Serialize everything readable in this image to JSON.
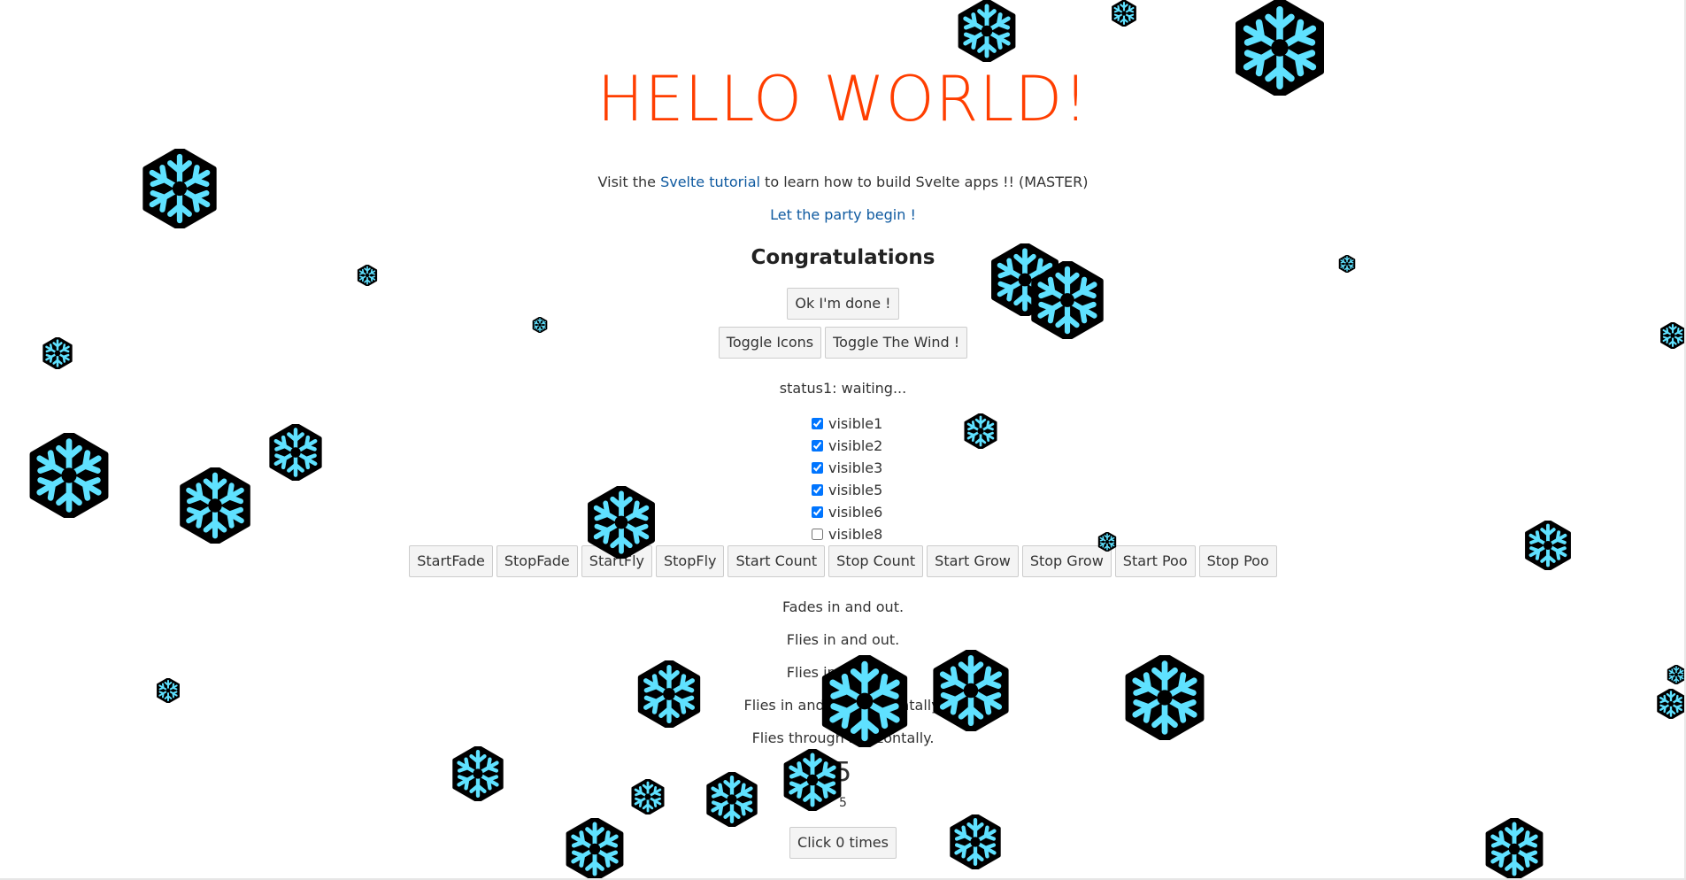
{
  "header": {
    "title": "HELLO WORLD!"
  },
  "intro": {
    "prefix": "Visit the ",
    "link": "Svelte tutorial",
    "suffix": " to learn how to build Svelte apps !! (MASTER)"
  },
  "party_link": "Let the party begin !",
  "congrats": "Congratulations",
  "buttons": {
    "done": "Ok I'm done !",
    "toggle_icons": "Toggle Icons",
    "toggle_wind": "Toggle The Wind !"
  },
  "status": "status1: waiting...",
  "checkboxes": [
    {
      "label": "visible1",
      "checked": true
    },
    {
      "label": "visible2",
      "checked": true
    },
    {
      "label": "visible3",
      "checked": true
    },
    {
      "label": "visible5",
      "checked": true
    },
    {
      "label": "visible6",
      "checked": true
    },
    {
      "label": "visible8",
      "checked": false
    }
  ],
  "controls": [
    "StartFade",
    "StopFade",
    "StartFly",
    "StopFly",
    "Start Count",
    "Stop Count",
    "Start Grow",
    "Stop Grow",
    "Start Poo",
    "Stop Poo"
  ],
  "messages": [
    "Fades in and out.",
    "Flies in and out.",
    "Flies in and out.",
    "Flies in and out horizontally.",
    "Flies through horizontally."
  ],
  "counter": {
    "big": "5",
    "small": "5"
  },
  "click_button": "Click 0 times",
  "colors": {
    "title": "#ff3e00",
    "link": "#0f5aa0",
    "flake_fill": "#5fe1ff",
    "flake_outline": "#000000"
  },
  "icon": "snowflake-icon"
}
